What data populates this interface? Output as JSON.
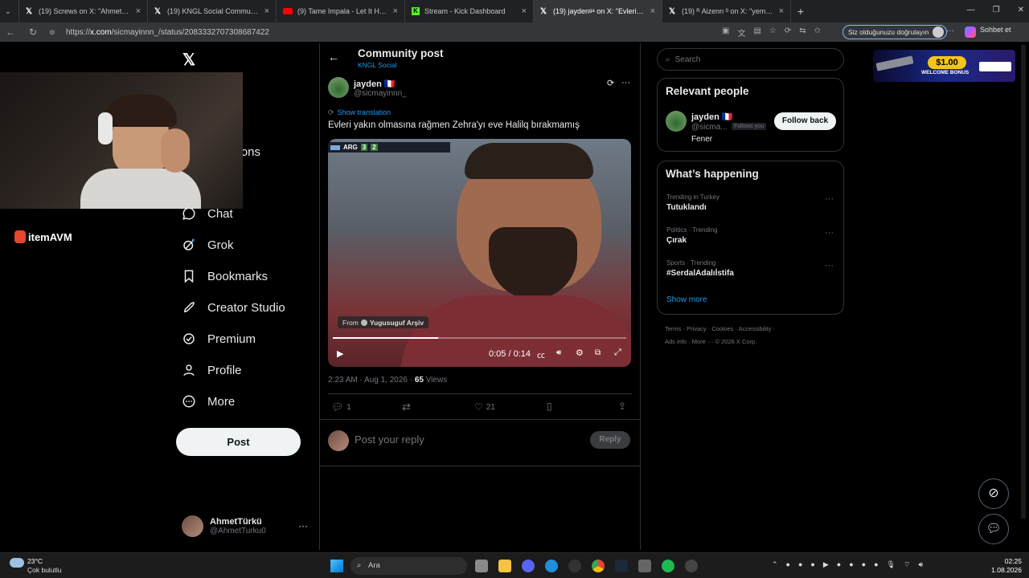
{
  "browser": {
    "tabs": [
      {
        "title": "(19) Screws on X: \"AhmetTurku Bu",
        "icon": "x-icon"
      },
      {
        "title": "(19) KNGL Social Community / X",
        "icon": "x-icon"
      },
      {
        "title": "(9) Tame Impala - Let It Happen (O",
        "icon": "youtube-icon"
      },
      {
        "title": "Stream - Kick Dashboard",
        "icon": "kick-icon"
      },
      {
        "title": "(19) jaydenᵍᵃ on X: \"Evleri yakın ol",
        "icon": "x-icon",
        "active": true
      },
      {
        "title": "(19) ᴿ Aizenn ᴽ on X: \"yemek yay",
        "icon": "x-icon"
      }
    ],
    "url_prefix": "https://",
    "url_domain": "x.com",
    "url_path": "/sicmayinnn_/status/2083332707308687422",
    "verify_label": "Siz olduğunuzu doğrulayın",
    "chat_label": "Sohbet et"
  },
  "sidebar": {
    "nav_partial_1": "e",
    "nav_partial_2": "ations",
    "items": [
      {
        "label": "Chat",
        "icon": "chat-icon"
      },
      {
        "label": "Grok",
        "icon": "grok-icon"
      },
      {
        "label": "Bookmarks",
        "icon": "bookmark-icon"
      },
      {
        "label": "Creator Studio",
        "icon": "rocket-icon"
      },
      {
        "label": "Premium",
        "icon": "premium-icon"
      },
      {
        "label": "Profile",
        "icon": "person-icon"
      },
      {
        "label": "More",
        "icon": "more-icon"
      }
    ],
    "post_label": "Post",
    "account_name": "AhmetTürkü",
    "account_handle": "@AhmetTurku0",
    "overlay_logo": "itemAVM"
  },
  "post": {
    "header_title": "Community post",
    "community": "KNGL Social",
    "author_name": "jayden 🇫🇷",
    "author_handle": "@sicmayinnn_",
    "show_translation": "Show translation",
    "text": "Evleri yakın olmasına rağmen Zehra'yı eve Halilq bırakmamış",
    "video_from_prefix": "From",
    "video_from": "Yugusuguf Arşiv",
    "video_time": "0:05 / 0:14",
    "video_progress": 0.36,
    "score_left": "ARG",
    "score_a": "3",
    "score_b": "2",
    "timestamp": "2:23 AM · Aug 1, 2026 · ",
    "views_count": "65",
    "views_label": " Views",
    "replies": "1",
    "likes": "21",
    "reply_placeholder": "Post your reply",
    "reply_button": "Reply"
  },
  "right": {
    "search_placeholder": "Search",
    "relevant_title": "Relevant people",
    "person_name": "jayden 🇫🇷",
    "person_handle": "@sicma...",
    "follows_you": "Follows you",
    "follow_back": "Follow back",
    "person_bio": "Fener",
    "happening_title": "What’s happening",
    "trends": [
      {
        "category": "Trending in Turkey",
        "title": "Tutuklandı"
      },
      {
        "category": "Politics · Trending",
        "title": "Çırak"
      },
      {
        "category": "Sports · Trending",
        "title": "#SerdalAdalıİstifa"
      }
    ],
    "show_more": "Show more",
    "footer_line1": "Terms · Privacy · Cookies · Accessibility ·",
    "footer_line2": "Ads info · More ··· © 2026 X Corp.",
    "ad_amount": "$1.00",
    "ad_text": "WELCOME BONUS"
  },
  "taskbar": {
    "temp": "23°C",
    "weather": "Çok bulutlu",
    "search": "Ara",
    "time": "02:25",
    "date": "1.08.2026"
  },
  "colors": {
    "accent": "#1d9bf0",
    "bg": "#000000",
    "border": "#2f3336"
  }
}
